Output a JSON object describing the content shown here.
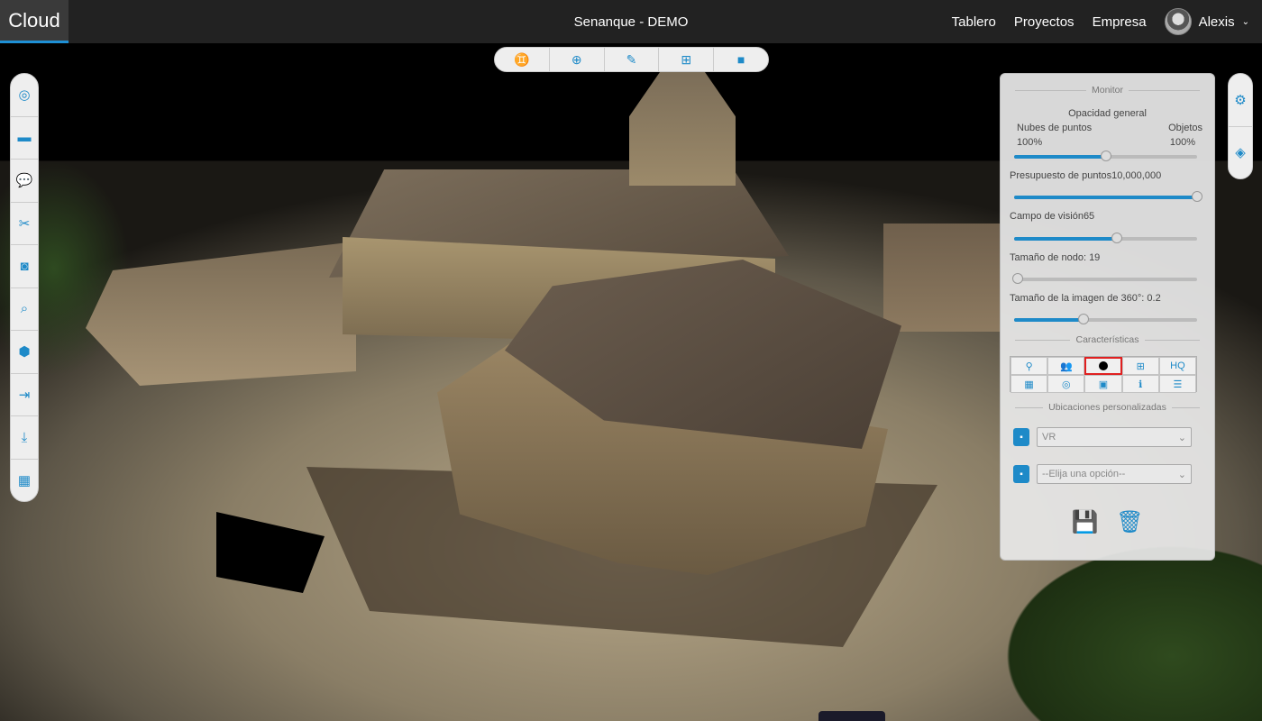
{
  "app": {
    "logo": "Cloud",
    "title": "Senanque - DEMO"
  },
  "nav": {
    "items": [
      "Tablero",
      "Proyectos",
      "Empresa"
    ],
    "user": "Alexis",
    "caret": "⌄"
  },
  "top_toolbar": [
    {
      "icon": "binoculars-icon",
      "glyph": "♊"
    },
    {
      "icon": "globe-icon",
      "glyph": "⊕"
    },
    {
      "icon": "brush-icon",
      "glyph": "✎"
    },
    {
      "icon": "vr-headset-icon",
      "glyph": "⊞"
    },
    {
      "icon": "square-icon",
      "glyph": "■"
    }
  ],
  "left_toolbar": [
    {
      "icon": "compass-icon",
      "glyph": "◎"
    },
    {
      "icon": "ruler-icon",
      "glyph": "▬"
    },
    {
      "icon": "comment-icon",
      "glyph": "💬"
    },
    {
      "icon": "scissors-icon",
      "glyph": "✂"
    },
    {
      "icon": "camera-icon",
      "glyph": "◙"
    },
    {
      "icon": "search-icon",
      "glyph": "⌕"
    },
    {
      "icon": "cube-icon",
      "glyph": "⬢"
    },
    {
      "icon": "file-import-icon",
      "glyph": "⇥"
    },
    {
      "icon": "download-icon",
      "glyph": "⤓"
    },
    {
      "icon": "grid-icon",
      "glyph": "▦"
    }
  ],
  "right_toolbar": [
    {
      "icon": "gears-icon",
      "glyph": "⚙"
    },
    {
      "icon": "layers-icon",
      "glyph": "◈"
    }
  ],
  "panel": {
    "section_monitor": "Monitor",
    "opacity_title": "Opacidad general",
    "point_clouds_label": "Nubes de puntos",
    "point_clouds_value": "100%",
    "objects_label": "Objetos",
    "objects_value": "100%",
    "opacity_balance": 0.5,
    "point_budget_label": "Presupuesto de puntos",
    "point_budget_value": "10,000,000",
    "point_budget_level": 1.0,
    "fov_label": "Campo de visión",
    "fov_value": "65",
    "fov_level": 0.56,
    "node_size_label": "Tamaño de nodo: 19",
    "node_size_level": 0.02,
    "image360_label": "Tamaño de la imagen de 360°: 0.2",
    "image360_level": 0.38,
    "section_features": "Características",
    "features": [
      {
        "icon": "map-pin-icon",
        "glyph": "⚲"
      },
      {
        "icon": "users-icon",
        "glyph": "👥"
      },
      {
        "icon": "point-icon",
        "glyph": ""
      },
      {
        "icon": "vr-icon",
        "glyph": "⊞"
      },
      {
        "icon": "hq-icon",
        "glyph": "HQ"
      },
      {
        "icon": "building-icon",
        "glyph": "▦"
      },
      {
        "icon": "target-icon",
        "glyph": "◎"
      },
      {
        "icon": "save-small-icon",
        "glyph": "▣"
      },
      {
        "icon": "info-icon",
        "glyph": "ℹ"
      },
      {
        "icon": "list-icon",
        "glyph": "☰"
      }
    ],
    "selected_feature": 2,
    "section_locations": "Ubicaciones personalizadas",
    "location_select_1": "VR",
    "location_select_2": "--Elija una opción--",
    "save_glyph": "💾",
    "delete_glyph": "🗑"
  }
}
